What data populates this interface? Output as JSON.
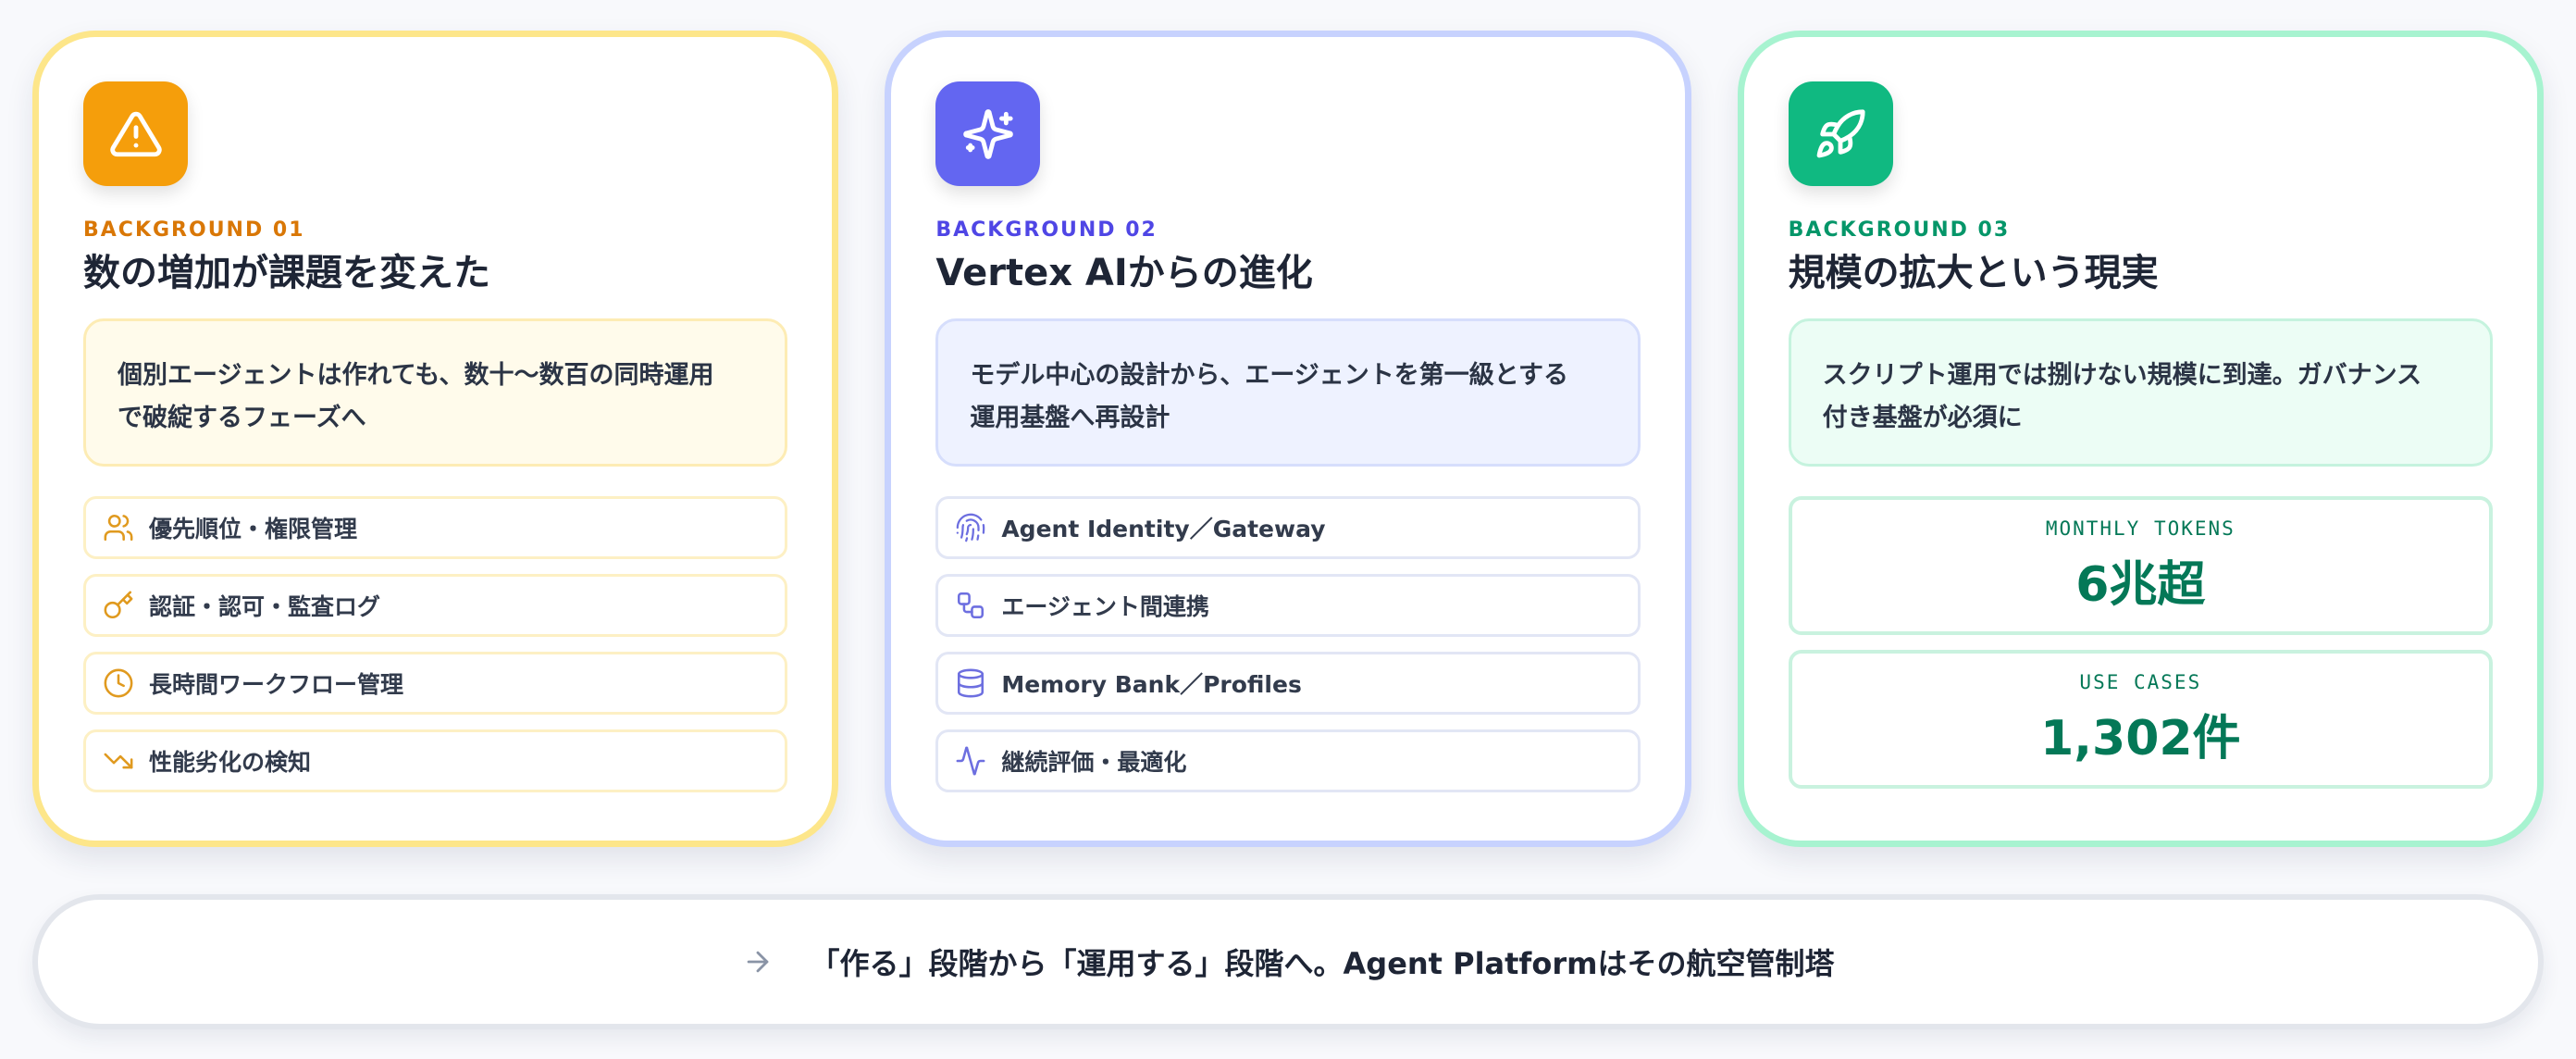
{
  "cards": [
    {
      "eyebrow": "BACKGROUND 01",
      "title": "数の増加が課題を変えた",
      "callout_line1": "個別エージェントは作れても、数十〜数百の同時運用",
      "callout_line2": "で破綻するフェーズへ",
      "icon": "warning-triangle-icon",
      "accent": "#f59e0b",
      "items": [
        {
          "label": "優先順位・権限管理",
          "icon": "users-icon"
        },
        {
          "label": "認証・認可・監査ログ",
          "icon": "key-icon"
        },
        {
          "label": "長時間ワークフロー管理",
          "icon": "clock-icon"
        },
        {
          "label": "性能劣化の検知",
          "icon": "trending-down-icon"
        }
      ]
    },
    {
      "eyebrow": "BACKGROUND 02",
      "title": "Vertex AIからの進化",
      "callout_line1": "モデル中心の設計から、エージェントを第一級とする",
      "callout_line2": "運用基盤へ再設計",
      "icon": "sparkles-icon",
      "accent": "#6366f1",
      "items": [
        {
          "label": "Agent Identity／Gateway",
          "icon": "fingerprint-icon"
        },
        {
          "label": "エージェント間連携",
          "icon": "workflow-icon"
        },
        {
          "label": "Memory Bank／Profiles",
          "icon": "database-icon"
        },
        {
          "label": "継続評価・最適化",
          "icon": "activity-icon"
        }
      ]
    },
    {
      "eyebrow": "BACKGROUND 03",
      "title": "規模の拡大という現実",
      "callout_line1": "スクリプト運用では捌けない規模に到達。ガバナンス",
      "callout_line2": "付き基盤が必須に",
      "icon": "rocket-icon",
      "accent": "#10b981",
      "stats": [
        {
          "label": "MONTHLY TOKENS",
          "value": "6兆超"
        },
        {
          "label": "USE CASES",
          "value": "1,302件"
        }
      ]
    }
  ],
  "banner": {
    "text": "「作る」段階から「運用する」段階へ。Agent Platformはその航空管制塔",
    "icon": "arrow-right-icon"
  }
}
